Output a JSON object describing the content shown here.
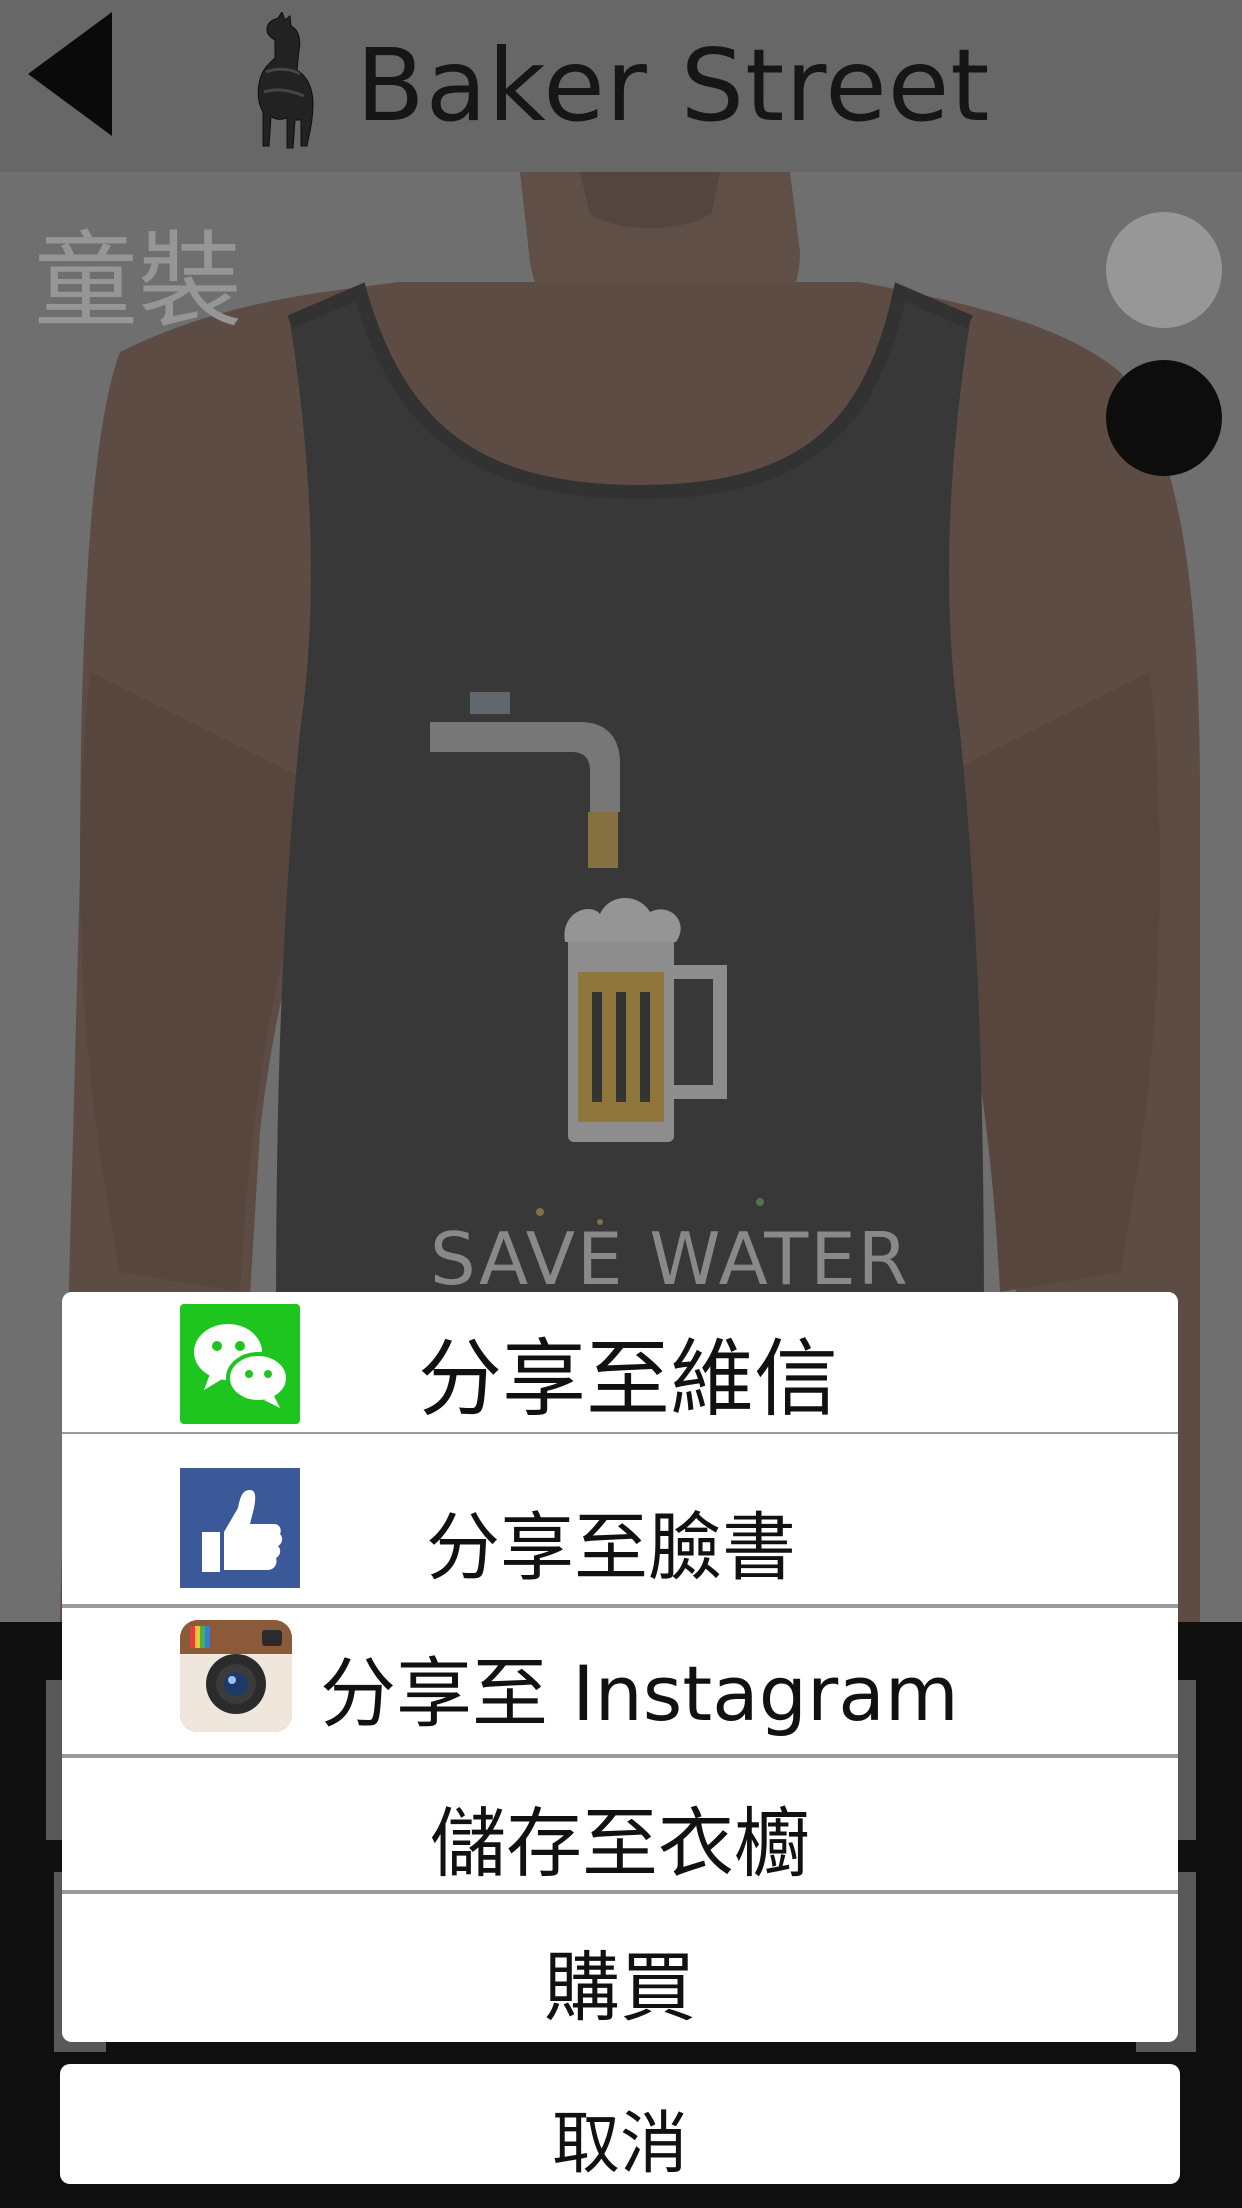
{
  "header": {
    "brand": "Baker Street",
    "back_icon": "back-arrow-icon",
    "logo_icon": "alpaca-logo-icon"
  },
  "product": {
    "category": "童裝",
    "shirt_print_text": "SAVE WATER",
    "colors": [
      {
        "name": "light-gray",
        "hex": "#b9b9b9"
      },
      {
        "name": "black",
        "hex": "#111111"
      }
    ]
  },
  "share_sheet": {
    "items": [
      {
        "label": "分享至維信",
        "icon": "wechat-icon"
      },
      {
        "label": "分享至臉書",
        "icon": "facebook-like-icon"
      },
      {
        "label": "分享至 Instagram",
        "icon": "instagram-icon"
      },
      {
        "label": "儲存至衣櫥",
        "icon": ""
      },
      {
        "label": "購買",
        "icon": ""
      }
    ],
    "cancel_label": "取消"
  },
  "colors": {
    "topbar": "#7e7e7e",
    "wechat_green": "#1ec51e",
    "facebook_blue": "#3b5898"
  }
}
